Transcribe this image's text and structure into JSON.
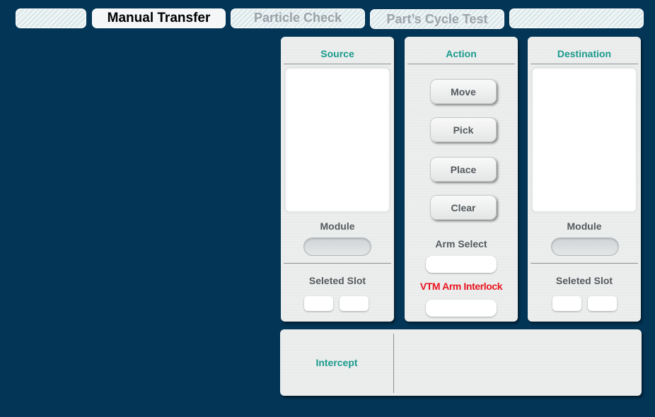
{
  "tabs": [
    {
      "label": ""
    },
    {
      "label": "Manual Transfer",
      "active": true
    },
    {
      "label": "Particle Check"
    },
    {
      "label": "Part’s Cycle Test"
    },
    {
      "label": ""
    }
  ],
  "source": {
    "title": "Source",
    "module_label": "Module",
    "slot_label": "Seleted Slot"
  },
  "action": {
    "title": "Action",
    "buttons": {
      "move": "Move",
      "pick": "Pick",
      "place": "Place",
      "clear": "Clear"
    },
    "arm_select_label": "Arm Select",
    "interlock_label": "VTM Arm Interlock"
  },
  "destination": {
    "title": "Destination",
    "module_label": "Module",
    "slot_label": "Seleted Slot"
  },
  "intercept": {
    "label": "Intercept"
  },
  "colors": {
    "background": "#033556",
    "title_accent": "#1a9a8c",
    "interlock_text": "#e8141e"
  }
}
